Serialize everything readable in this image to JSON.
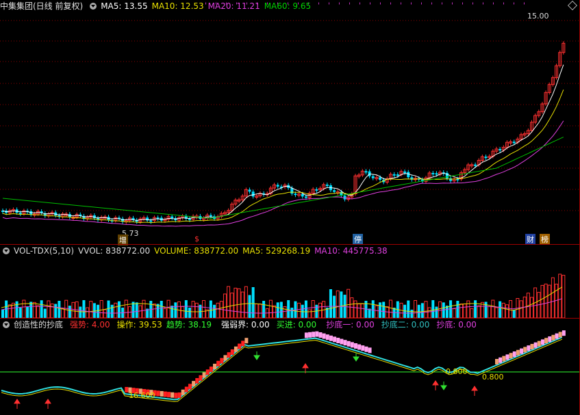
{
  "colors": {
    "ma5": "#ffffff",
    "ma10": "#e8e000",
    "ma20": "#e040e0",
    "ma60": "#00c000",
    "up": "#ff3030",
    "down": "#00e0ff",
    "grid": "#8b0000"
  },
  "main": {
    "title": "中集集团(日线 前复权)",
    "ma5": "MA5: 13.55",
    "ma10": "MA10: 12.53",
    "ma20": "MA20: 11.21",
    "ma60": "MA60: 9.65",
    "high_label": "15.00",
    "low_label": "5.73",
    "markers": [
      "增",
      "$",
      "停",
      "财",
      "榜"
    ]
  },
  "vol": {
    "title": "VOL-TDX(5,10)",
    "vvol": "VVOL: 838772.00",
    "volume": "VOLUME: 838772.00",
    "ma5": "MA5: 529268.19",
    "ma10": "MA10: 445775.38"
  },
  "ind": {
    "title": "创造性的抄底",
    "qiangshi": "强势: 4.00",
    "caozuo": "操作: 39.53",
    "qushi": "趋势: 38.19",
    "qiangruojie": "强弱界: 0.00",
    "mairu": "买进: 0.00",
    "chaodi1": "抄底一: 0.00",
    "chaodi2": "抄底二: 0.00",
    "chaodi": "抄底: 0.00",
    "labels": [
      "16.600",
      "0.800",
      "0.800"
    ]
  }
}
